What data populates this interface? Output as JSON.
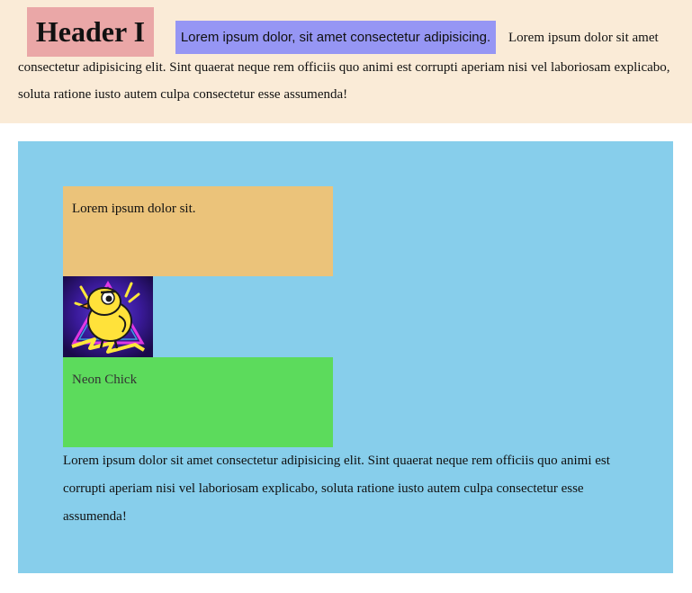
{
  "header": {
    "title": "Header I",
    "highlight_text": "Lorem ipsum dolor, sit amet consectetur adipisicing.",
    "paragraph_first_line": "Lorem ipsum dolor sit amet",
    "paragraph_rest": "consectetur adipisicing elit. Sint quaerat neque rem officiis quo animi est corrupti aperiam nisi vel laboriosam explicabo, soluta ratione iusto autem culpa consectetur esse assumenda!"
  },
  "main": {
    "card_orange_text": "Lorem ipsum dolor sit.",
    "image_icon": "neon-chick-image",
    "card_green_text": "Neon Chick",
    "paragraph": "Lorem ipsum dolor sit amet consectetur adipisicing elit. Sint quaerat neque rem officiis quo animi est corrupti aperiam nisi vel laboriosam explicabo, soluta ratione iusto autem culpa consectetur esse assumenda!"
  },
  "colors": {
    "top_background": "#faebd7",
    "header_background": "#eaa7a7",
    "highlight_background": "#9696f4",
    "panel_background": "#87ceeb",
    "card_orange": "#ebc37a",
    "card_green": "#5cdb5c"
  }
}
